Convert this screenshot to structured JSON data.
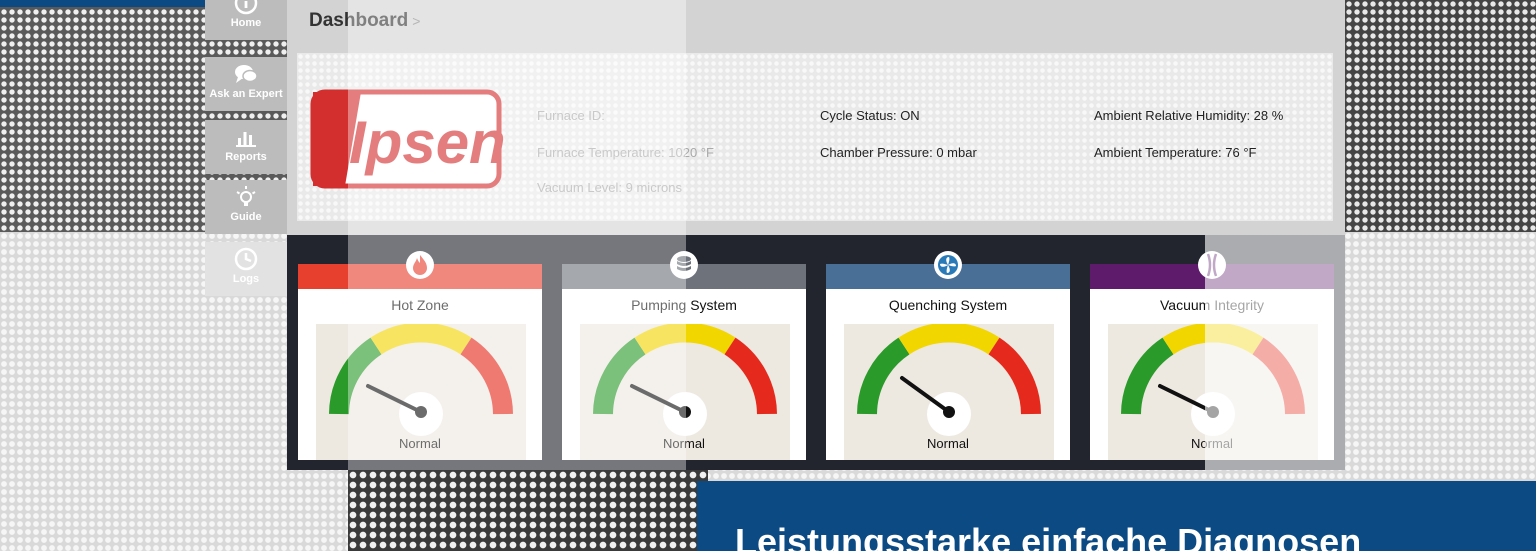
{
  "sidebar": {
    "items": [
      {
        "label": "Home",
        "icon": "info-icon"
      },
      {
        "label": "Ask an Expert",
        "icon": "chat-bubbles-icon"
      },
      {
        "label": "Reports",
        "icon": "bar-chart-icon"
      },
      {
        "label": "Guide",
        "icon": "lightbulb-icon"
      },
      {
        "label": "Logs",
        "icon": "clock-icon"
      }
    ]
  },
  "breadcrumb": {
    "title": "Dashboard",
    "separator": ">"
  },
  "logo": {
    "text": "Ipsen",
    "color": "#d32f2f"
  },
  "info": {
    "furnace_id": "Furnace ID:",
    "furnace_temperature": "Furnace Temperature: 1020 °F",
    "vacuum_level": "Vacuum Level: 9 microns",
    "cycle_status": "Cycle Status: ON",
    "chamber_pressure": "Chamber Pressure: 0 mbar",
    "ambient_humidity": "Ambient Relative Humidity: 28 %",
    "ambient_temperature": "Ambient Temperature: 76 °F"
  },
  "gauges": [
    {
      "title": "Hot Zone",
      "status": "Normal",
      "header_color": "#e8402e",
      "icon": "flame-icon"
    },
    {
      "title": "Pumping System",
      "status": "Normal",
      "header_color": "#6e737b",
      "icon": "database-icon"
    },
    {
      "title": "Quenching System",
      "status": "Normal",
      "header_color": "#4a6f96",
      "icon": "fan-icon"
    },
    {
      "title": "Vacuum Integrity",
      "status": "Normal",
      "header_color": "#5e1b6c",
      "icon": "vacuum-icon"
    }
  ],
  "banner": {
    "text": "Leistungsstarke einfache Diagnosen"
  },
  "colors": {
    "brand_blue": "#0c4a83",
    "gauge_green": "#2a9a2a",
    "gauge_yellow": "#f2d600",
    "gauge_red": "#e5291c"
  }
}
